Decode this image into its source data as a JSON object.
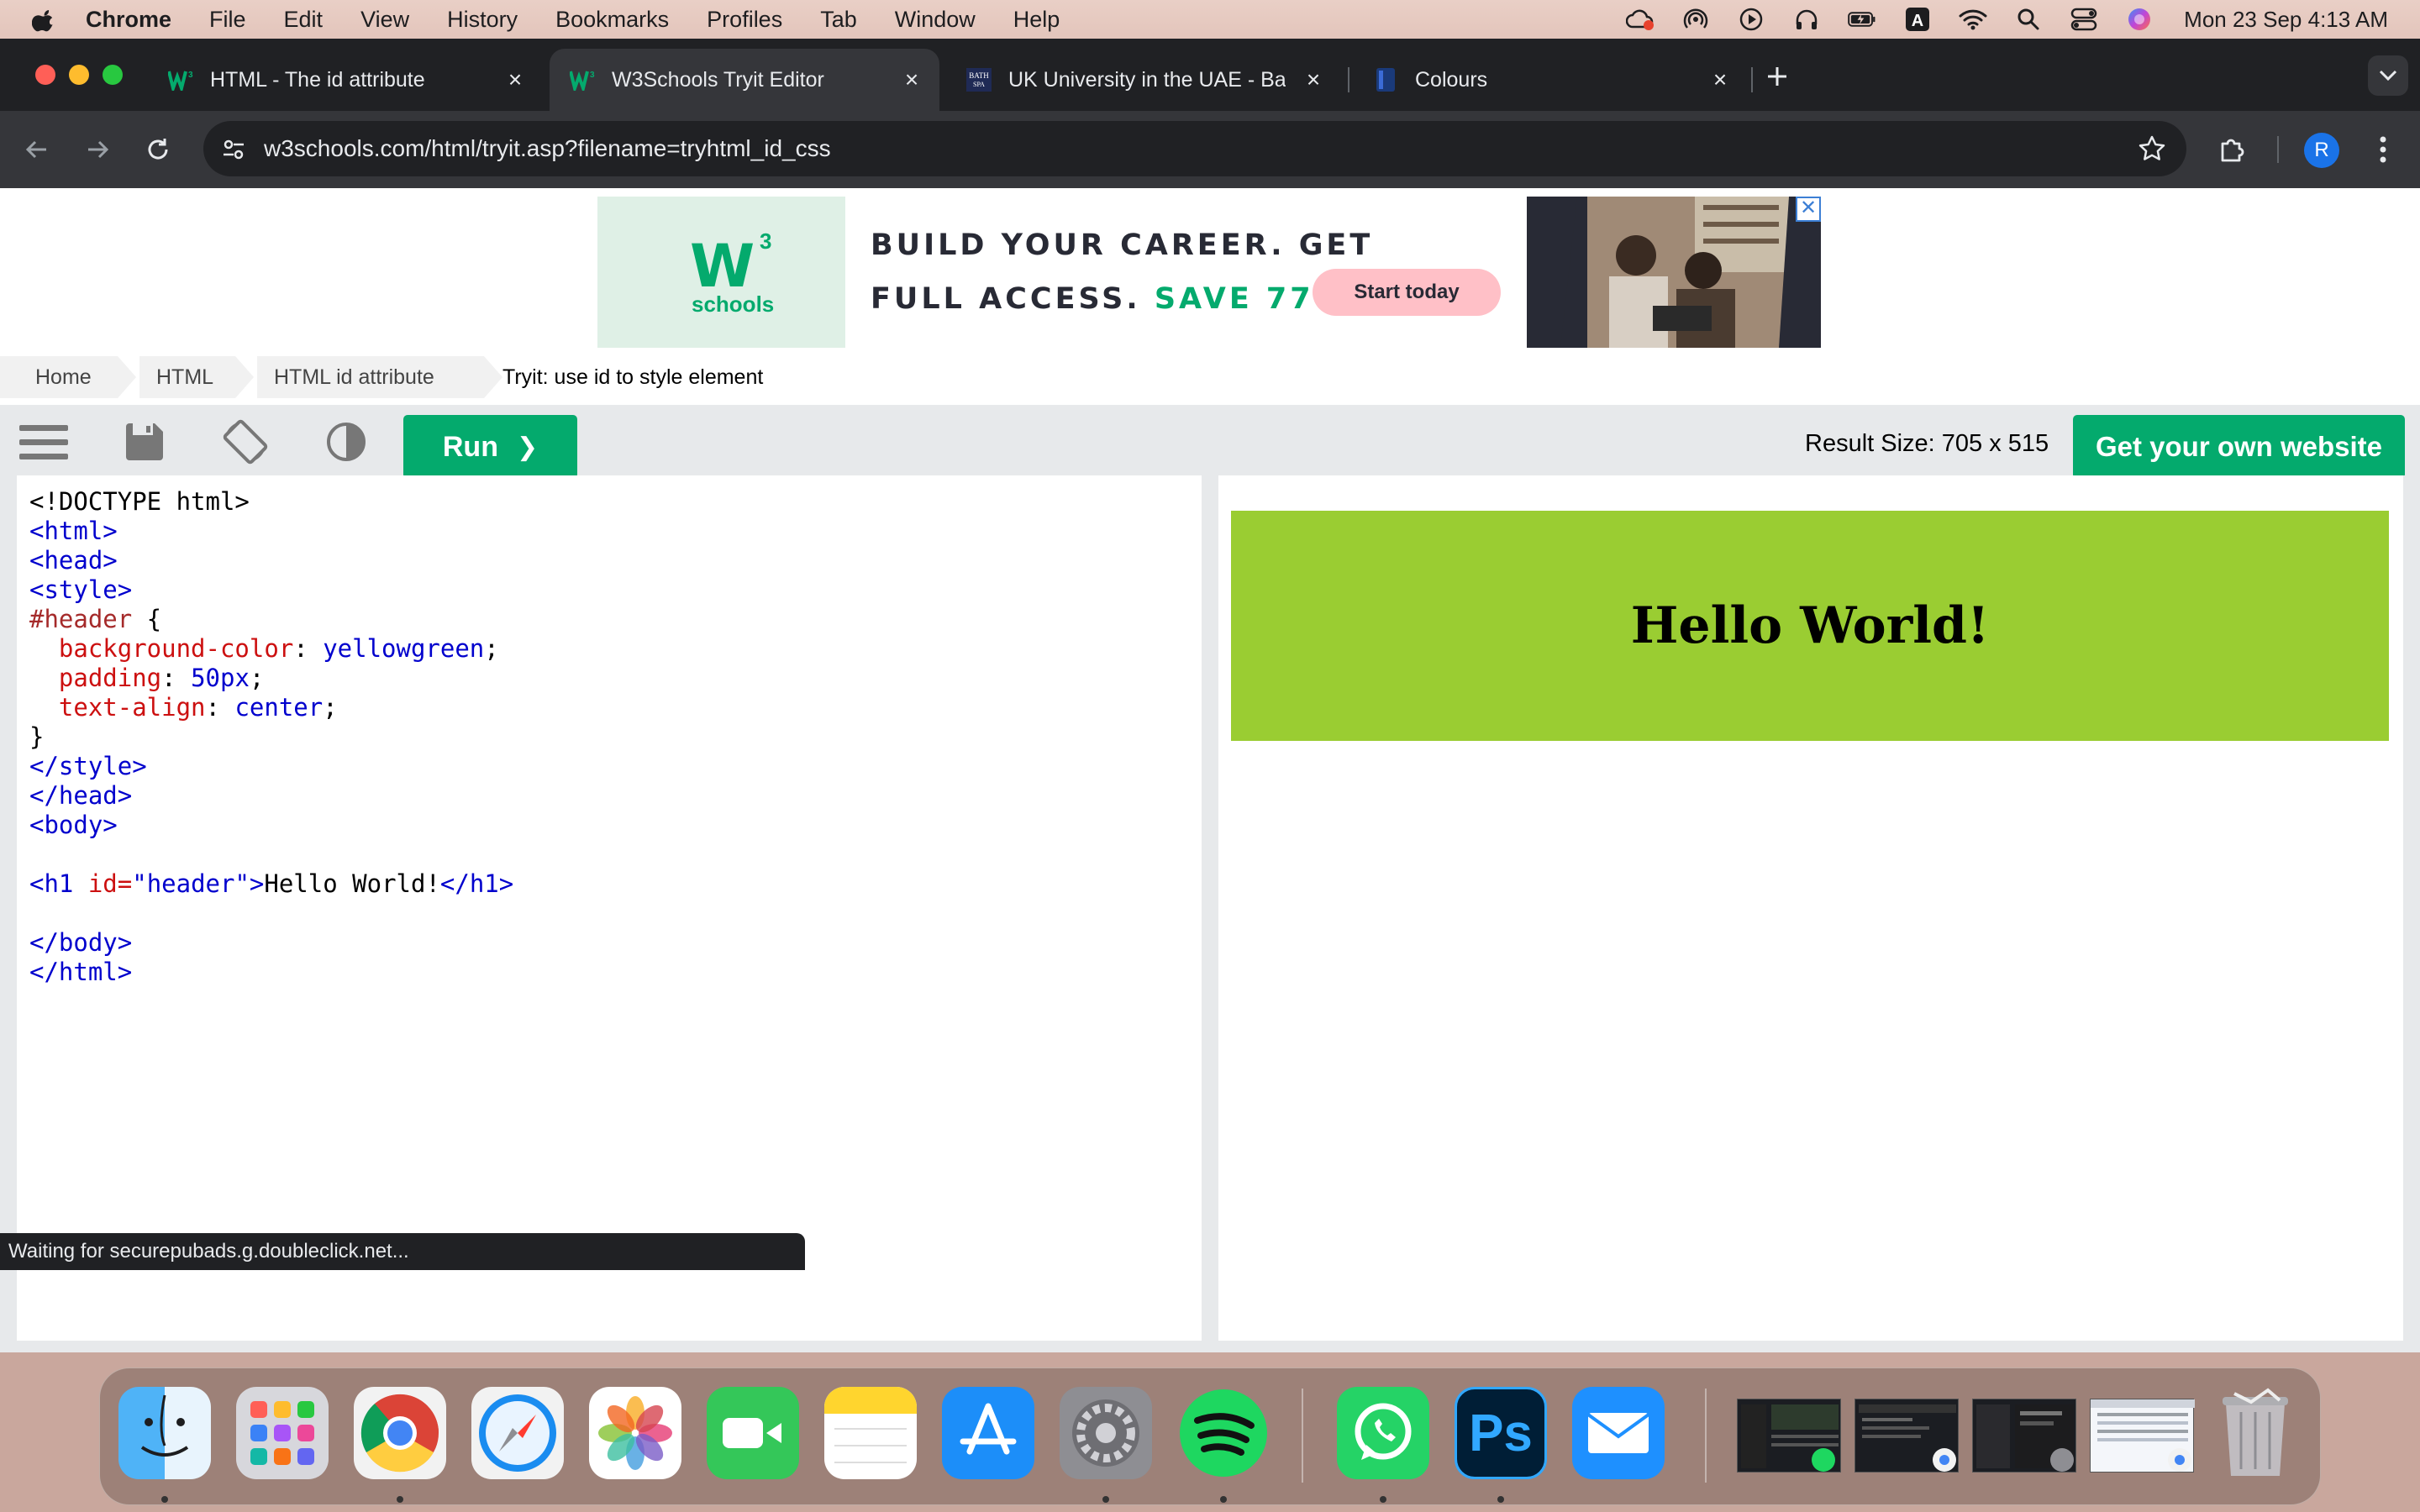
{
  "menubar": {
    "app_name": "Chrome",
    "items": [
      "File",
      "Edit",
      "View",
      "History",
      "Bookmarks",
      "Profiles",
      "Tab",
      "Window",
      "Help"
    ],
    "clock": "Mon 23 Sep  4:13 AM"
  },
  "tabs": [
    {
      "title": "HTML - The id attribute",
      "icon": "w3schools-favicon"
    },
    {
      "title": "W3Schools Tryit Editor",
      "icon": "w3schools-favicon",
      "active": true
    },
    {
      "title": "UK University in the UAE - Ba",
      "icon": "bath-spa-favicon"
    },
    {
      "title": "Colours",
      "icon": "doc-favicon"
    }
  ],
  "address_bar": {
    "url": "w3schools.com/html/tryit.asp?filename=tryhtml_id_css"
  },
  "profile_initial": "R",
  "ad": {
    "logo_mark": "W",
    "logo_sup": "3",
    "logo_text": "schools",
    "line1": "BUILD YOUR CAREER. GET",
    "line2_prefix": "FULL ACCESS.",
    "line2_accent": "SAVE 770$",
    "cta": "Start today",
    "close": "✕"
  },
  "breadcrumb": {
    "items": [
      "Home",
      "HTML",
      "HTML id attribute"
    ],
    "current": "Tryit: use id to style element"
  },
  "tryit": {
    "run_label": "Run",
    "run_arrow": "❯",
    "result_size": "Result Size: 705 x 515",
    "own_website": "Get your own website"
  },
  "code": {
    "l1": "<!DOCTYPE html>",
    "l2": "<html>",
    "l3": "<head>",
    "l4": "<style>",
    "l5_sel": "#header",
    "l5_brace": " {",
    "l6_prop": "background-color",
    "l6_val": "yellowgreen",
    "l7_prop": "padding",
    "l7_val": "50px",
    "l8_prop": "text-align",
    "l8_val": "center",
    "l9": "}",
    "l10": "</style>",
    "l11": "</head>",
    "l12": "<body>",
    "l14_open": "<h1",
    "l14_attr": " id=",
    "l14_attrval": "\"header\"",
    "l14_gt": ">",
    "l14_text": "Hello World!",
    "l14_close": "</h1>",
    "l16": "</body>",
    "l17": "</html>"
  },
  "result": {
    "heading": "Hello World!",
    "bg_color": "#9acd32"
  },
  "status_text": "Waiting for securepubads.g.doubleclick.net...",
  "colors": {
    "w3_green": "#04aa6d",
    "tab_bg": "#202124",
    "toolbar_bg": "#35363a"
  },
  "dock": [
    "finder",
    "launchpad",
    "chrome",
    "safari",
    "photos",
    "facetime",
    "notes",
    "app-store",
    "system-settings",
    "spotify",
    "whatsapp",
    "photoshop",
    "mail",
    "window-thumbnail",
    "window-thumbnail",
    "window-thumbnail",
    "window-thumbnail",
    "trash"
  ],
  "dock_labels": {
    "photoshop": "Ps"
  }
}
